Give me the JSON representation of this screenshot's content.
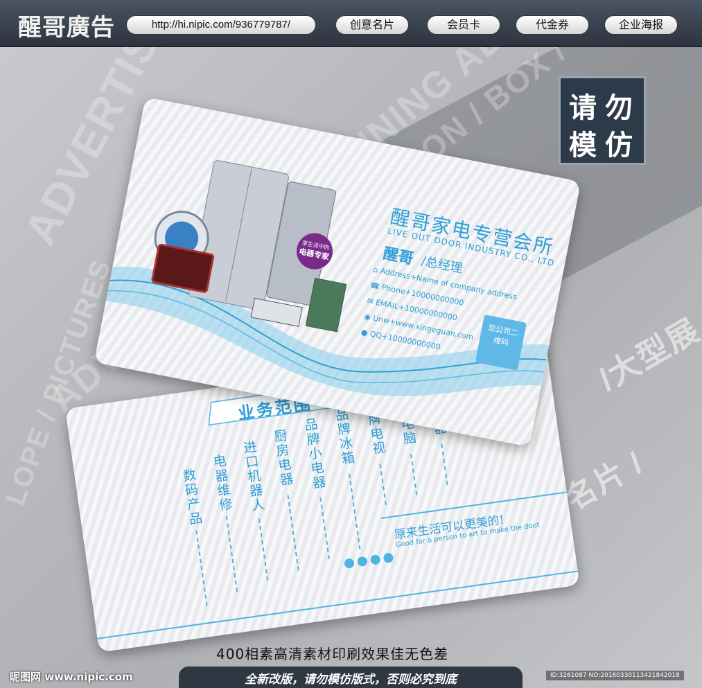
{
  "header": {
    "logo": "醒哥廣告",
    "url": "http://hi.nipic.com/936779787/",
    "nav": [
      "创意名片",
      "会员卡",
      "代金券",
      "企业海报"
    ]
  },
  "stamp": [
    "请",
    "勿",
    "模",
    "仿"
  ],
  "front_card": {
    "company_cn": "醒哥家电专营会所",
    "company_en": "LIVE OUT DOOR INDUSTRY CO., LTD",
    "name": "醒哥",
    "title": "/总经理",
    "badge_small": "享生活中的",
    "badge_big": "电器专家",
    "contacts": [
      {
        "icon": "home-icon",
        "text": "Address+Name of company address"
      },
      {
        "icon": "phone-icon",
        "text": "Phone+10000000000"
      },
      {
        "icon": "mail-icon",
        "text": "EMAIL+10000000000"
      },
      {
        "icon": "globe-icon",
        "text": "Unw+www.xingeguan.com"
      },
      {
        "icon": "qq-icon",
        "text": "QQ+10000000000"
      }
    ],
    "qr_text": "您公司二维码"
  },
  "back_card": {
    "heading": "业务范围",
    "items": [
      "数码产品",
      "电器维修",
      "进口机器人",
      "厨房电器",
      "品牌小电器",
      "品牌冰箱",
      "品牌电视",
      "品牌电脑",
      "家用电器"
    ],
    "slogan_cn": "原来生活可以更美的!",
    "slogan_en": "Good for a person to art to make the doot"
  },
  "bg_words": [
    "ADVERTISING",
    "ADVERTISING / PLANNING ADVER",
    "EXHIBITION / BOX / HOUSE",
    "LOPE / PICTURES",
    "/大型展",
    "/名片 /"
  ],
  "caption": "400相素高清素材印刷效果佳无色差",
  "footer": {
    "site": "昵图网 www.nipic.com",
    "notice": "全新改版，请勿模仿版式，否则必究到底",
    "id_text": "ID:3261087 NO:20160330113421842018"
  },
  "colors": {
    "accent": "#2f9fd6",
    "bar": "#2e3440"
  }
}
